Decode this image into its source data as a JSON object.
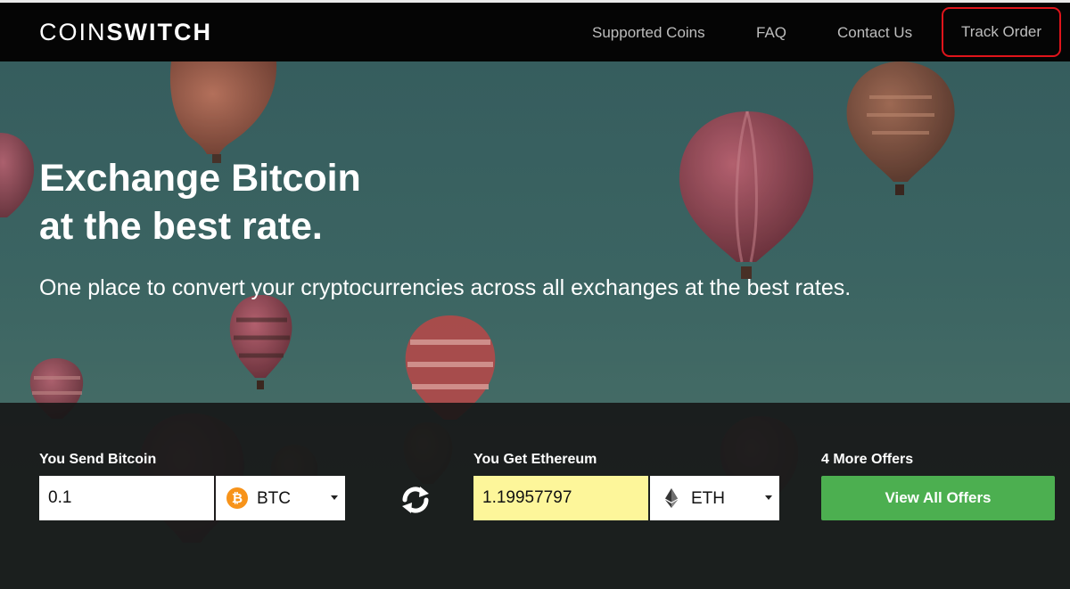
{
  "brand": {
    "logo_light": "COIN",
    "logo_bold": "SWITCH"
  },
  "nav": {
    "supported_coins": "Supported Coins",
    "faq": "FAQ",
    "contact_us": "Contact Us",
    "track_order": "Track Order",
    "highlight_color": "#e0141b"
  },
  "hero": {
    "headline_line1": "Exchange Bitcoin",
    "headline_line2": "at the best rate.",
    "subheadline": "One place to convert your cryptocurrencies across all exchanges at the best rates."
  },
  "exchange": {
    "send": {
      "label": "You Send Bitcoin",
      "amount": "0.1",
      "coin_code": "BTC",
      "coin_icon": "bitcoin-icon",
      "coin_color": "#f7931a"
    },
    "swap_icon": "swap-arrows-icon",
    "get": {
      "label": "You Get Ethereum",
      "amount": "1.19957797",
      "coin_code": "ETH",
      "coin_icon": "ethereum-icon",
      "highlight_color": "#fdf69a"
    },
    "offers": {
      "label": "4 More Offers",
      "button": "View All Offers",
      "button_color": "#4caf50"
    }
  }
}
